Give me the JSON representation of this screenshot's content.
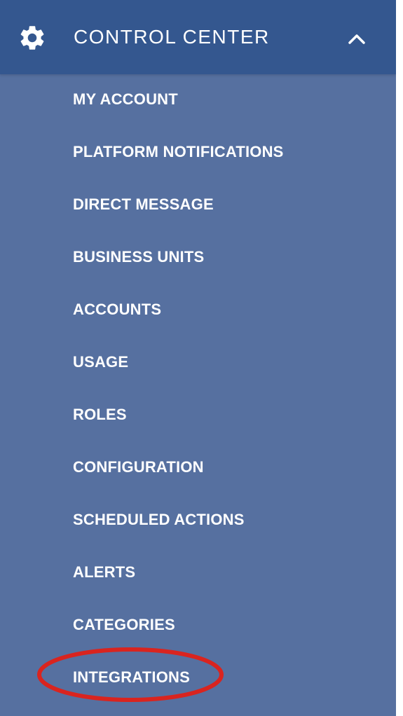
{
  "header": {
    "title": "CONTROL CENTER",
    "icon": "gear-icon",
    "toggle_icon": "chevron-up-icon"
  },
  "menu": {
    "items": [
      {
        "label": "MY ACCOUNT"
      },
      {
        "label": "PLATFORM NOTIFICATIONS"
      },
      {
        "label": "DIRECT MESSAGE"
      },
      {
        "label": "BUSINESS UNITS"
      },
      {
        "label": "ACCOUNTS"
      },
      {
        "label": "USAGE"
      },
      {
        "label": "ROLES"
      },
      {
        "label": "CONFIGURATION"
      },
      {
        "label": "SCHEDULED ACTIONS"
      },
      {
        "label": "ALERTS"
      },
      {
        "label": "CATEGORIES"
      },
      {
        "label": "INTEGRATIONS"
      }
    ]
  },
  "annotation": {
    "highlighted_item": "INTEGRATIONS",
    "color": "#d9241f"
  },
  "colors": {
    "header_bg": "#34578f",
    "sidebar_bg": "#5670a0",
    "text": "#ffffff"
  }
}
